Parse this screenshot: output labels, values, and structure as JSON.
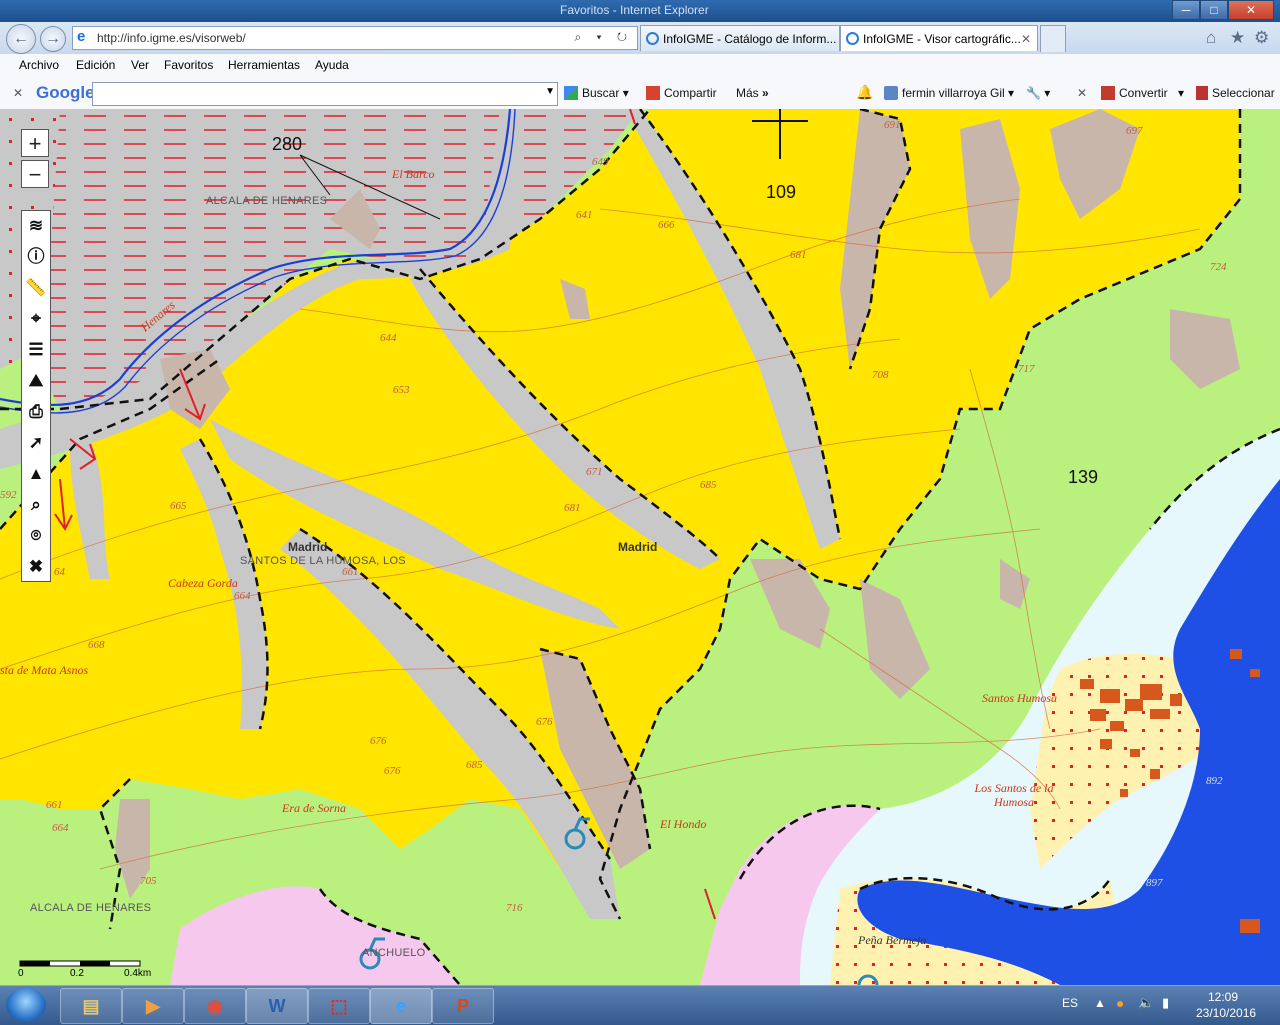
{
  "window": {
    "title": "Favoritos - Internet Explorer",
    "controls": {
      "minimize": "─",
      "maximize": "□",
      "close": "✕"
    }
  },
  "nav": {
    "back_icon": "arrow-left-icon",
    "forward_icon": "arrow-right-icon",
    "address": "http://info.igme.es/visorweb/",
    "address_tools": "⌕ ▾ ↻"
  },
  "tabs": [
    {
      "label": "InfoIGME - Catálogo de Inform...",
      "active": false
    },
    {
      "label": "InfoIGME - Visor cartográfic...",
      "active": true,
      "close": "✕"
    }
  ],
  "menu": [
    "Archivo",
    "Edición",
    "Ver",
    "Favoritos",
    "Herramientas",
    "Ayuda"
  ],
  "google_toolbar": {
    "close": "✕",
    "logo": "Google",
    "search_value": "",
    "search": "Buscar",
    "share": "Compartir",
    "more": "Más",
    "more_arrows": "»",
    "user": "fermin villarroya Gil",
    "close2": "✕",
    "convert": "Convertir",
    "select": "Seleccionar"
  },
  "map": {
    "unit_labels": [
      "280",
      "109",
      "139"
    ],
    "toponyms": [
      "El Barco",
      "Henares",
      "Cabeza Gorda",
      "sta de Mata Asnos",
      "Era de Sorna",
      "El Hondo",
      "Santos Humosa",
      "Los Santos de la Humosa",
      "Peña Bermeja"
    ],
    "placenames": [
      "ALCALA DE HENARES",
      "SANTOS DE LA HUMOSA, LOS",
      "ALCALA DE HENARES",
      "ANCHUELO"
    ],
    "bold_places": [
      "Madrid",
      "Madrid"
    ],
    "contours": [
      "649",
      "641",
      "666",
      "681",
      "644",
      "653",
      "671",
      "681",
      "685",
      "708",
      "717",
      "724",
      "665",
      "661",
      "664",
      "668",
      "676",
      "676",
      "676",
      "685",
      "661",
      "664",
      "705",
      "716",
      "697",
      "691",
      "592",
      "64",
      "892",
      "897"
    ],
    "scale": {
      "zero": "0",
      "mid": "0.2",
      "end": "0.4km"
    }
  },
  "map_tools": {
    "zoom_in": "+",
    "zoom_out": "−"
  },
  "taskbar": {
    "apps": [
      "explorer-icon",
      "media-player-icon",
      "chrome-icon",
      "word-icon",
      "pdf-icon",
      "ie-icon",
      "powerpoint-icon"
    ],
    "lang": "ES",
    "time": "12:09",
    "date": "23/10/2016"
  },
  "colors": {
    "yellow_unit": "#ffe500",
    "green_unit": "#b9f07e",
    "grey_unit": "#c8c8c8",
    "brown_unit": "#c9b6aa",
    "pink_unit": "#f7c8ee",
    "blue_unit": "#1e50e6",
    "cream_unit": "#fff1b0",
    "light_cyan": "#e6f8fb"
  }
}
